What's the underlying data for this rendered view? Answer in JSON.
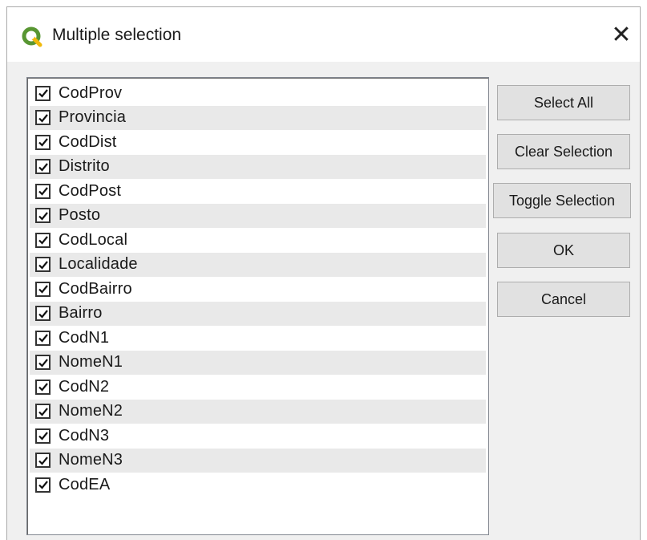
{
  "window": {
    "title": "Multiple selection",
    "close_icon": "close-icon",
    "app_icon": "qgis-logo-icon",
    "accent_color": "#589632"
  },
  "list": {
    "items": [
      {
        "label": "CodProv",
        "checked": true
      },
      {
        "label": "Provincia",
        "checked": true
      },
      {
        "label": "CodDist",
        "checked": true
      },
      {
        "label": "Distrito",
        "checked": true
      },
      {
        "label": "CodPost",
        "checked": true
      },
      {
        "label": "Posto",
        "checked": true
      },
      {
        "label": "CodLocal",
        "checked": true
      },
      {
        "label": "Localidade",
        "checked": true
      },
      {
        "label": "CodBairro",
        "checked": true
      },
      {
        "label": "Bairro",
        "checked": true
      },
      {
        "label": "CodN1",
        "checked": true
      },
      {
        "label": "NomeN1",
        "checked": true
      },
      {
        "label": "CodN2",
        "checked": true
      },
      {
        "label": "NomeN2",
        "checked": true
      },
      {
        "label": "CodN3",
        "checked": true
      },
      {
        "label": "NomeN3",
        "checked": true
      },
      {
        "label": "CodEA",
        "checked": true
      }
    ]
  },
  "buttons": {
    "select_all": "Select All",
    "clear_selection": "Clear Selection",
    "toggle_selection": "Toggle Selection",
    "ok": "OK",
    "cancel": "Cancel"
  }
}
